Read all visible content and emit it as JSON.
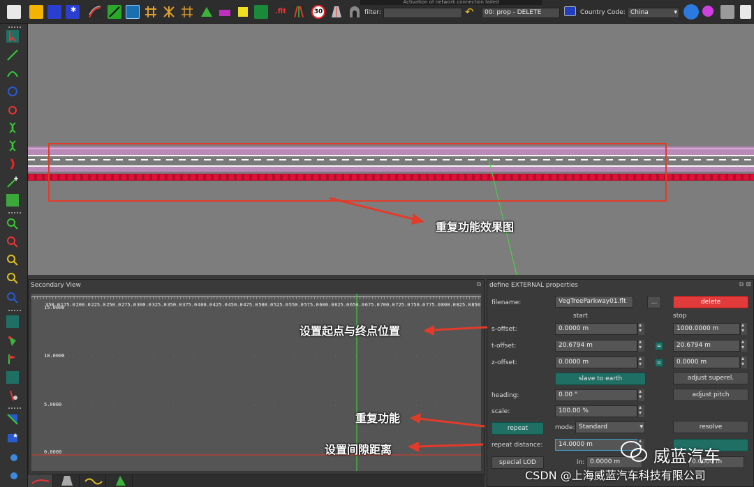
{
  "toolbar": {
    "banner": "Activation of network connection failed",
    "filter_label": "filter:",
    "filter_value": "",
    "action_value": "00: prop - DELETE",
    "country_label": "Country Code:",
    "country_value": "China",
    "speed_sign_label": "30",
    "fit_label": ".flt"
  },
  "secondary_view": {
    "title": "Secondary View",
    "ruler_labels": [
      "350.0",
      "175.0",
      "200.0",
      "225.0",
      "250.0",
      "275.0",
      "300.0",
      "325.0",
      "350.0",
      "375.0",
      "400.0",
      "425.0",
      "450.0",
      "475.0",
      "500.0",
      "525.0",
      "550.0",
      "575.0",
      "600.0",
      "625.0",
      "650.0",
      "675.0",
      "700.0",
      "725.0",
      "750.0",
      "775.0",
      "800.0",
      "825.0",
      "850.0"
    ],
    "y_labels": [
      "15.0000",
      "10.0000",
      "5.0000",
      "0.0000"
    ]
  },
  "props": {
    "title": "define EXTERNAL properties",
    "filename_label": "filename:",
    "filename_value": "VegTreeParkway01.flt",
    "browse_label": "...",
    "delete_label": "delete",
    "start_label": "start",
    "stop_label": "stop",
    "s_offset_label": "s-offset:",
    "s_offset_start": "0.0000 m",
    "s_offset_stop": "1000.0000 m",
    "t_offset_label": "t-offset:",
    "t_offset_start": "20.6794 m",
    "t_offset_stop": "20.6794 m",
    "z_offset_label": "z-offset:",
    "z_offset_start": "0.0000 m",
    "z_offset_stop": "0.0000 m",
    "eq_label": "=",
    "slave_label": "slave to earth",
    "adjust_superel_label": "adjust superel.",
    "heading_label": "heading:",
    "heading_value": "0.00 °",
    "adjust_pitch_label": "adjust pitch",
    "scale_label": "scale:",
    "scale_value": "100.00 %",
    "repeat_label": "repeat",
    "mode_label": "mode:",
    "mode_value": "Standard",
    "resolve_label": "resolve",
    "repeat_distance_label": "repeat distance:",
    "repeat_distance_value": "14.0000 m",
    "special_lod_label": "special LOD",
    "in_label": "in:",
    "in_value": "0.0000 m",
    "out_value": "0.0000 m"
  },
  "annotations": {
    "effect": "重复功能效果图",
    "start_end": "设置起点与终点位置",
    "repeat": "重复功能",
    "gap": "设置间隙距离"
  },
  "watermark": {
    "name": "威蓝汽车",
    "credit": "CSDN @上海威蓝汽车科技有限公司"
  },
  "colors": {
    "highlight_box": "#e23b2a",
    "teal": "#1f6f65",
    "delete_red": "#e23b3b"
  }
}
